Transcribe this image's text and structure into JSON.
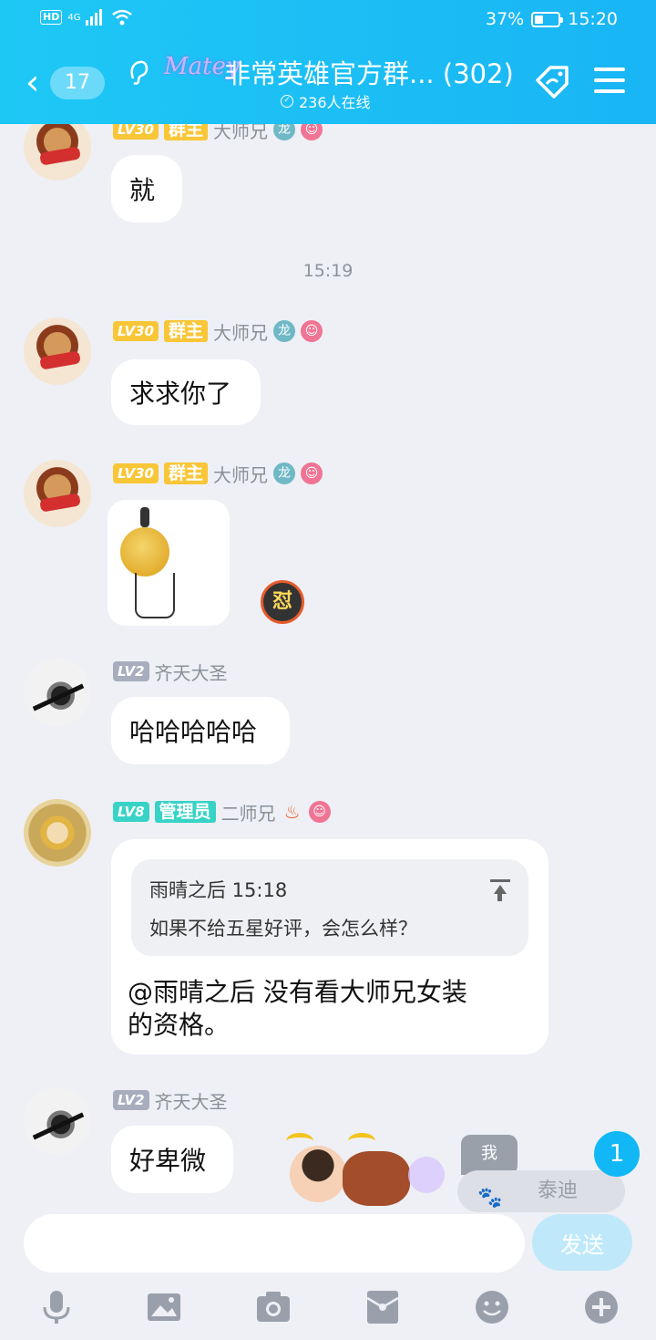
{
  "status_bar": {
    "network": "HD",
    "signal": "4G",
    "battery": "37%",
    "battery_level": 0.37,
    "time": "15:20"
  },
  "header": {
    "back_count": "17",
    "logo_text": "Matey",
    "title": "非常英雄官方群...",
    "member_count": "(302)",
    "online": "236人在线"
  },
  "messages": [
    {
      "level": "LV30",
      "role": "群主",
      "name": "大师兄",
      "text": "就"
    },
    {
      "time": "15:19"
    },
    {
      "level": "LV30",
      "role": "群主",
      "name": "大师兄",
      "text": "求求你了"
    },
    {
      "level": "LV30",
      "role": "群主",
      "name": "大师兄",
      "sticker_reaction": "怼"
    },
    {
      "level": "LV2",
      "name": "齐天大圣",
      "text": "哈哈哈哈哈"
    },
    {
      "level": "LV8",
      "role": "管理员",
      "name": "二师兄",
      "quote_header": "雨晴之后 15:18",
      "quote_body": "如果不给五星好评，会怎么样？",
      "text_line1": "@雨晴之后 没有看大师兄女装",
      "text_line2": "的资格。"
    },
    {
      "level": "LV2",
      "name": "齐天大圣",
      "text": "好卑微"
    }
  ],
  "overlay": {
    "me_label": "我",
    "teddy_label": "泰迪",
    "new_count": "1"
  },
  "input": {
    "placeholder": "",
    "send_label": "发送"
  },
  "toolbar": {
    "icons": [
      "mic-icon",
      "image-icon",
      "camera-icon",
      "red-packet-icon",
      "emoji-icon",
      "plus-icon"
    ]
  },
  "colors": {
    "header": "#1ec8f5",
    "accent": "#12b7f5",
    "bg": "#eef0f5",
    "lvl_gold": "#f9c638",
    "lvl_gray": "#a7adbd",
    "lvl_teal": "#38d3c6"
  }
}
